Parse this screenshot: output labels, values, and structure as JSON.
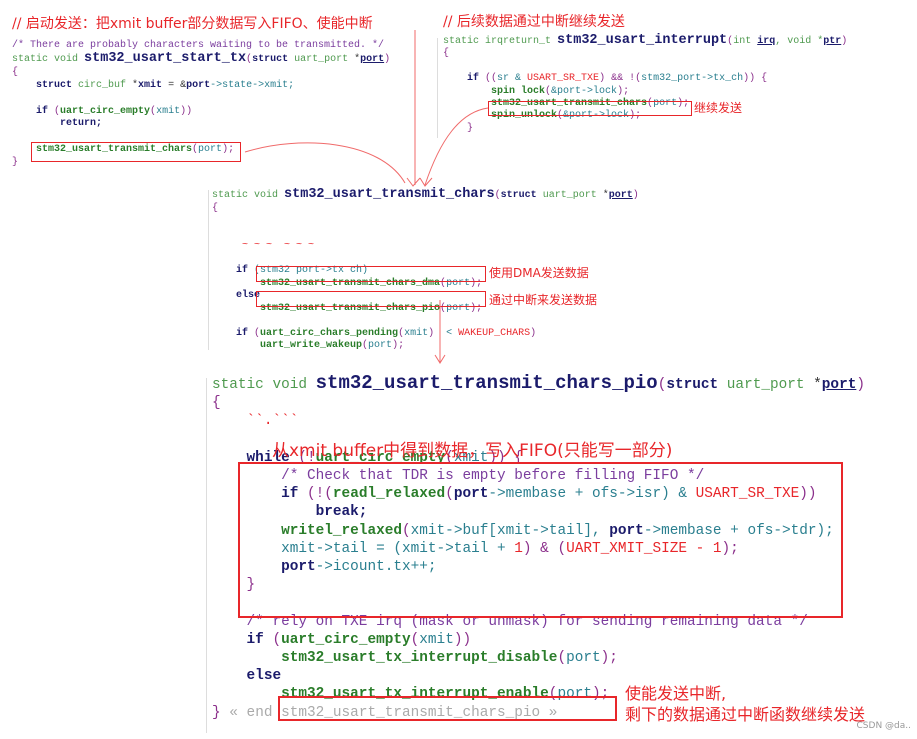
{
  "annotations": {
    "start_tx": "// 启动发送：把xmit buffer部分数据写入FIFO、使能中断",
    "interrupt": "// 后续数据通过中断继续发送",
    "continue_send": "继续发送",
    "use_dma": "使用DMA发送数据",
    "use_interrupt": "通过中断来发送数据",
    "fifo_write": "从xmit buffer中得到数据，写入FIFO(只能写一部分)",
    "enable_irq_1": "使能发送中断,",
    "enable_irq_2": "剩下的数据通过中断函数继续发送"
  },
  "watermark": "CSDN @da..",
  "accent_color": "#e8262a",
  "blocks": {
    "b1": [
      [
        [
          "/* There are probably characters waiting to be transmitted. */",
          "c"
        ]
      ],
      [
        [
          "static void ",
          "i"
        ],
        [
          "stm32_usart_start_tx",
          "b"
        ],
        [
          "(",
          "o"
        ],
        [
          "struct ",
          "k"
        ],
        [
          "uart_port ",
          "i"
        ],
        [
          "*",
          "d"
        ],
        [
          "port",
          "u"
        ],
        [
          ")",
          "o"
        ]
      ],
      [
        [
          "{",
          "o"
        ]
      ],
      [
        [
          "    struct ",
          "k"
        ],
        [
          "circ_buf ",
          "i"
        ],
        [
          "*",
          "d"
        ],
        [
          "xmit",
          "k"
        ],
        [
          " = &",
          "d"
        ],
        [
          "port",
          "k"
        ],
        [
          "->state->xmit;",
          "p"
        ]
      ],
      [],
      [
        [
          "    if ",
          "k"
        ],
        [
          "(",
          "o"
        ],
        [
          "uart_circ_empty",
          "f"
        ],
        [
          "(",
          "o"
        ],
        [
          "xmit",
          "p"
        ],
        [
          "))",
          "o"
        ]
      ],
      [
        [
          "        return;",
          "k"
        ]
      ],
      [],
      [
        [
          "    stm32_usart_transmit_chars",
          "f"
        ],
        [
          "(",
          "o"
        ],
        [
          "port",
          "p"
        ],
        [
          ");",
          "o"
        ]
      ],
      [
        [
          "}",
          "o"
        ]
      ]
    ],
    "b2": [
      [
        [
          "static irqreturn_t ",
          "i"
        ],
        [
          "stm32_usart_interrupt",
          "b"
        ],
        [
          "(",
          "o"
        ],
        [
          "int ",
          "i"
        ],
        [
          "irq",
          "u"
        ],
        [
          ", void *",
          "i"
        ],
        [
          "ptr",
          "u"
        ],
        [
          ")",
          "o"
        ]
      ],
      [
        [
          "{",
          "o"
        ]
      ],
      [],
      [
        [
          "    if ",
          "k"
        ],
        [
          "((",
          "o"
        ],
        [
          "sr & ",
          "p"
        ],
        [
          "USART_SR_TXE",
          "m"
        ],
        [
          ") && !(",
          "o"
        ],
        [
          "stm32_port->tx_ch",
          "p"
        ],
        [
          ")) {",
          "o"
        ]
      ],
      [
        [
          "        spin lock",
          "f"
        ],
        [
          "(",
          "o"
        ],
        [
          "&port->lock",
          "p"
        ],
        [
          ");",
          "o"
        ]
      ],
      [
        [
          "        stm32_usart_transmit_chars",
          "f"
        ],
        [
          "(",
          "o"
        ],
        [
          "port",
          "p"
        ],
        [
          ");",
          "o"
        ]
      ],
      [
        [
          "        spin_unlock",
          "f"
        ],
        [
          "(",
          "o"
        ],
        [
          "&port->lock",
          "p"
        ],
        [
          ");",
          "o"
        ]
      ],
      [
        [
          "    }",
          "o"
        ]
      ]
    ],
    "b3": [
      [
        [
          "static void ",
          "i"
        ],
        [
          "stm32_usart_transmit_chars",
          "b"
        ],
        [
          "(",
          "o"
        ],
        [
          "struct ",
          "k"
        ],
        [
          "uart_port ",
          "i"
        ],
        [
          "*",
          "d"
        ],
        [
          "port",
          "u"
        ],
        [
          ")",
          "o"
        ]
      ],
      [
        [
          "{",
          "o"
        ]
      ],
      [],
      [],
      [
        [
          "     ~ ~ ~  ~ ~ ~",
          "m"
        ]
      ],
      [],
      [
        [
          "    if ",
          "k"
        ],
        [
          "(stm32 port->tx ch)",
          "p"
        ]
      ],
      [
        [
          "        stm32_usart_transmit_chars_dma",
          "f"
        ],
        [
          "(",
          "o"
        ],
        [
          "port",
          "p"
        ],
        [
          ");",
          "o"
        ]
      ],
      [
        [
          "    else",
          "k"
        ]
      ],
      [
        [
          "        stm32_usart_transmit_chars_pio",
          "f"
        ],
        [
          "(",
          "o"
        ],
        [
          "port",
          "p"
        ],
        [
          ");",
          "o"
        ]
      ],
      [],
      [
        [
          "    if ",
          "k"
        ],
        [
          "(",
          "o"
        ],
        [
          "uart_circ_chars_pending",
          "f"
        ],
        [
          "(",
          "o"
        ],
        [
          "xmit",
          "p"
        ],
        [
          ")",
          "o"
        ],
        [
          "  < ",
          "p"
        ],
        [
          "WAKEUP_CHARS",
          "m"
        ],
        [
          ")",
          "o"
        ]
      ],
      [
        [
          "        uart_write_wakeup",
          "f"
        ],
        [
          "(",
          "o"
        ],
        [
          "port",
          "p"
        ],
        [
          ");",
          "o"
        ]
      ]
    ],
    "b4": [
      [
        [
          "static void ",
          "i"
        ],
        [
          "stm32_usart_transmit_chars_pio",
          "b"
        ],
        [
          "(",
          "o"
        ],
        [
          "struct ",
          "k"
        ],
        [
          "uart_port ",
          "i"
        ],
        [
          "*",
          "d"
        ],
        [
          "port",
          "u"
        ],
        [
          ")",
          "o"
        ]
      ],
      [
        [
          "{",
          "o"
        ]
      ],
      [
        [
          "    ``.```",
          "m"
        ]
      ],
      [],
      [
        [
          "    while ",
          "k"
        ],
        [
          "(!",
          "o"
        ],
        [
          "uart_circ_empty",
          "f"
        ],
        [
          "(",
          "o"
        ],
        [
          "xmit",
          "p"
        ],
        [
          ")) {",
          "o"
        ]
      ],
      [
        [
          "        /* Check that TDR is empty before filling FIFO */",
          "c"
        ]
      ],
      [
        [
          "        if ",
          "k"
        ],
        [
          "(!(",
          "o"
        ],
        [
          "readl_relaxed",
          "f"
        ],
        [
          "(",
          "o"
        ],
        [
          "port",
          "k"
        ],
        [
          "->membase + ofs->isr) & ",
          "p"
        ],
        [
          "USART_SR_TXE",
          "m"
        ],
        [
          "))",
          "o"
        ]
      ],
      [
        [
          "            break;",
          "k"
        ]
      ],
      [
        [
          "        writel_relaxed",
          "f"
        ],
        [
          "(",
          "o"
        ],
        [
          "xmit->buf[xmit->tail], ",
          "p"
        ],
        [
          "port",
          "k"
        ],
        [
          "->membase + ofs->tdr);",
          "p"
        ]
      ],
      [
        [
          "        xmit->tail = (xmit->tail + ",
          "p"
        ],
        [
          "1",
          "m"
        ],
        [
          ") & (",
          "o"
        ],
        [
          "UART_XMIT_SIZE - 1",
          "m"
        ],
        [
          ");",
          "o"
        ]
      ],
      [
        [
          "        port",
          "k"
        ],
        [
          "->icount.tx++;",
          "p"
        ]
      ],
      [
        [
          "    }",
          "o"
        ]
      ],
      [],
      [
        [
          "    /* rely on TXE irq (mask or unmask) for sending remaining data */",
          "c"
        ]
      ],
      [
        [
          "    if ",
          "k"
        ],
        [
          "(",
          "o"
        ],
        [
          "uart_circ_empty",
          "f"
        ],
        [
          "(",
          "o"
        ],
        [
          "xmit",
          "p"
        ],
        [
          "))",
          "o"
        ]
      ],
      [
        [
          "        stm32_usart_tx_interrupt_disable",
          "f"
        ],
        [
          "(",
          "o"
        ],
        [
          "port",
          "p"
        ],
        [
          ");",
          "o"
        ]
      ],
      [
        [
          "    else",
          "k"
        ]
      ],
      [
        [
          "        stm32_usart_tx_interrupt_enable",
          "f"
        ],
        [
          "(",
          "o"
        ],
        [
          "port",
          "p"
        ],
        [
          ");",
          "o"
        ]
      ],
      [
        [
          "} ",
          "o"
        ],
        [
          "« end stm32_usart_transmit_chars_pio »",
          "g"
        ]
      ]
    ]
  }
}
